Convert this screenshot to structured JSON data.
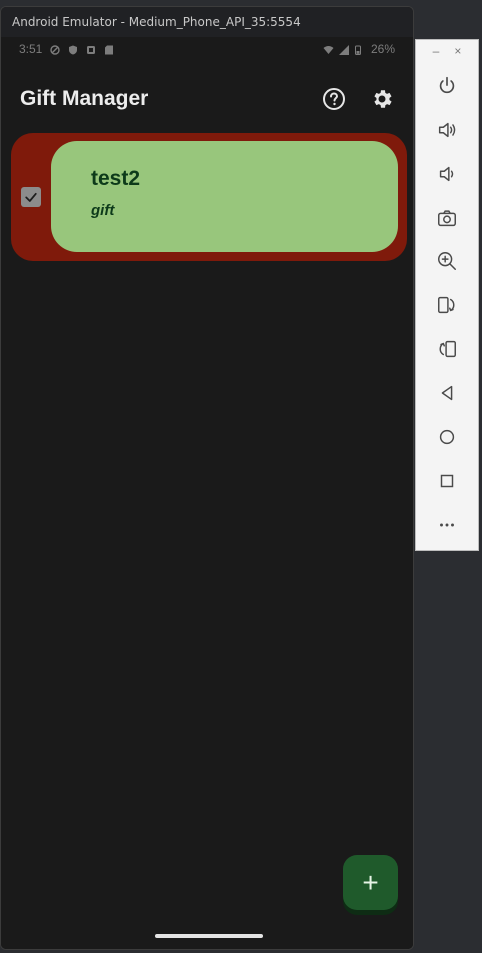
{
  "emulator": {
    "title": "Android Emulator - Medium_Phone_API_35:5554"
  },
  "status_bar": {
    "time": "3:51",
    "battery": "26%"
  },
  "app_bar": {
    "title": "Gift Manager",
    "help_icon": "help-circle-icon",
    "settings_icon": "gear-icon"
  },
  "card": {
    "title": "test2",
    "subtitle": "gift",
    "checked": true,
    "colors": {
      "outer": "#7f1a0b",
      "inner": "#98c67c",
      "text": "#0d3a1a"
    }
  },
  "fab": {
    "label": "+"
  },
  "toolbar": {
    "minimize": "–",
    "close": "×",
    "buttons": [
      "power-icon",
      "volume-up-icon",
      "volume-down-icon",
      "camera-icon",
      "zoom-in-icon",
      "rotate-left-icon",
      "rotate-right-icon",
      "back-icon",
      "home-icon",
      "overview-icon",
      "more-icon"
    ]
  }
}
